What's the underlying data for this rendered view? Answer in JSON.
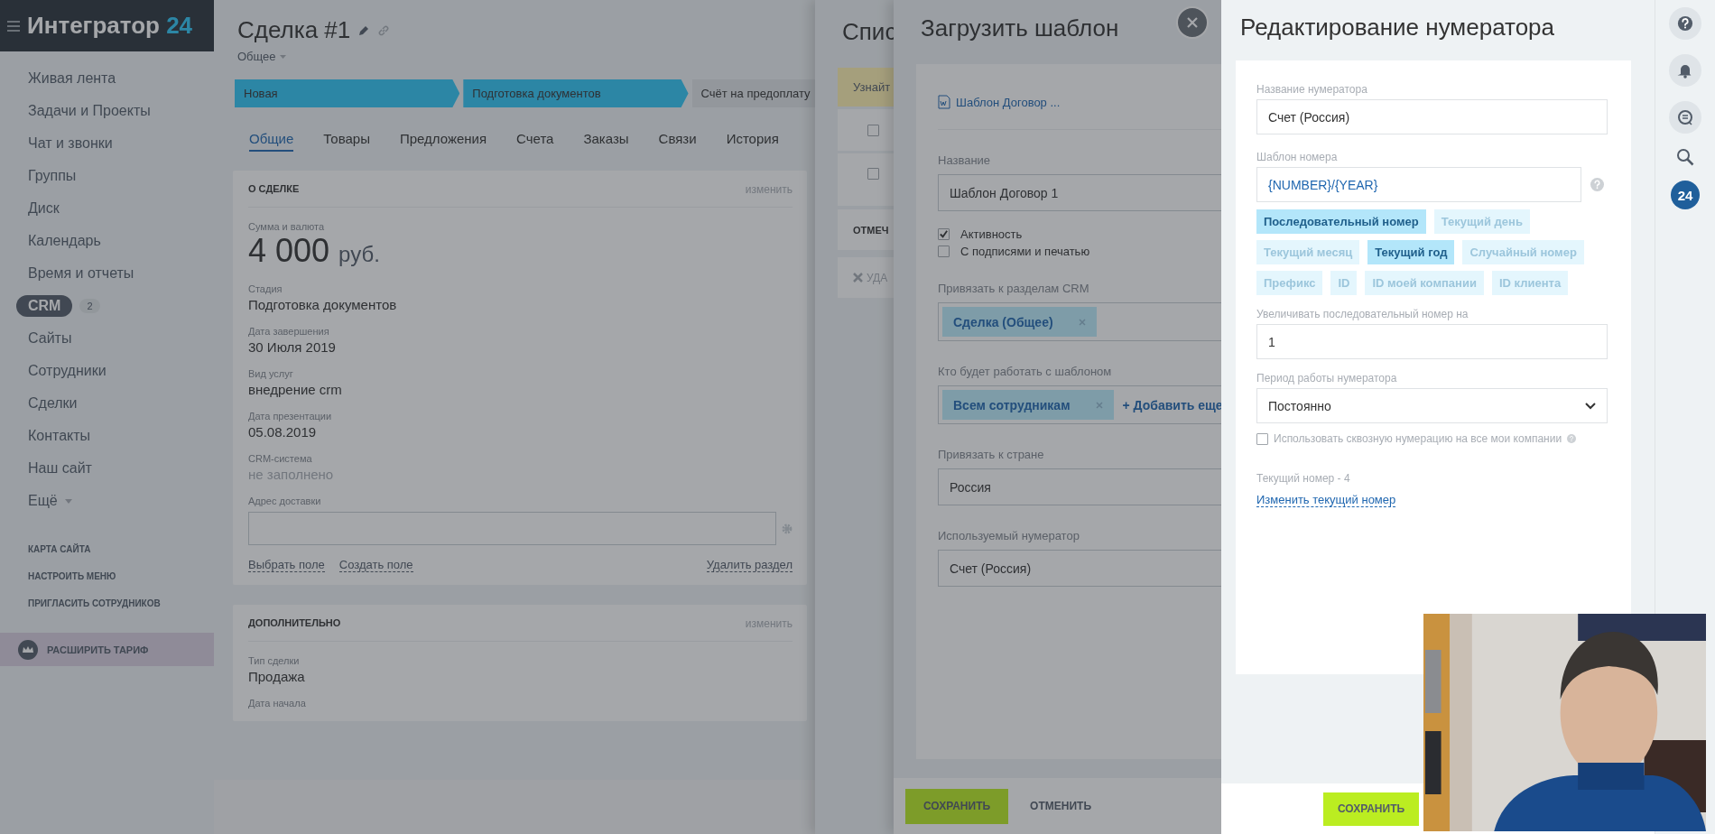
{
  "sidebar": {
    "logo": "Интегратор",
    "logo_number": "24",
    "items": [
      {
        "label": "Живая лента",
        "selected": false
      },
      {
        "label": "Задачи и Проекты",
        "selected": false
      },
      {
        "label": "Чат и звонки",
        "selected": false
      },
      {
        "label": "Группы",
        "selected": false
      },
      {
        "label": "Диск",
        "selected": false
      },
      {
        "label": "Календарь",
        "selected": false
      },
      {
        "label": "Время и отчеты",
        "selected": false
      },
      {
        "label": "CRM",
        "selected": true,
        "badge": "2"
      },
      {
        "label": "Сайты",
        "selected": false
      },
      {
        "label": "Сотрудники",
        "selected": false
      },
      {
        "label": "Сделки",
        "selected": false
      },
      {
        "label": "Контакты",
        "selected": false
      },
      {
        "label": "Наш сайт",
        "selected": false
      },
      {
        "label": "Ещё",
        "selected": false,
        "expandable": true
      }
    ],
    "links": [
      "КАРТА САЙТА",
      "НАСТРОИТЬ МЕНЮ",
      "ПРИГЛАСИТЬ СОТРУДНИКОВ"
    ],
    "upgrade": "РАСШИРИТЬ ТАРИФ"
  },
  "deal": {
    "title": "Сделка #1",
    "category": "Общее",
    "stages": [
      {
        "label": "Новая",
        "reached": true
      },
      {
        "label": "Подготовка документов",
        "reached": true
      },
      {
        "label": "Счёт на предоплату",
        "reached": false
      }
    ],
    "tabs": [
      {
        "label": "Общие",
        "selected": true
      },
      {
        "label": "Товары",
        "selected": false
      },
      {
        "label": "Предложения",
        "selected": false
      },
      {
        "label": "Счета",
        "selected": false
      },
      {
        "label": "Заказы",
        "selected": false
      },
      {
        "label": "Связи",
        "selected": false
      },
      {
        "label": "История",
        "selected": false
      }
    ],
    "sections": [
      {
        "title": "О СДЕЛКЕ",
        "edit": "изменить",
        "fields": [
          {
            "kind": "money",
            "label": "Сумма и валюта",
            "value": "4 000",
            "currency": "руб."
          },
          {
            "kind": "text",
            "label": "Стадия",
            "value": "Подготовка документов"
          },
          {
            "kind": "text",
            "label": "Дата завершения",
            "value": "30 Июля 2019"
          },
          {
            "kind": "text",
            "label": "Вид услуг",
            "value": "внедрение crm"
          },
          {
            "kind": "text",
            "label": "Дата презентации",
            "value": "05.08.2019"
          },
          {
            "kind": "empty",
            "label": "CRM-система",
            "value": "не заполнено"
          },
          {
            "kind": "input",
            "label": "Адрес доставки"
          }
        ],
        "actions": [
          "Выбрать поле",
          "Создать поле"
        ],
        "remove": "Удалить раздел"
      },
      {
        "title": "ДОПОЛНИТЕЛЬНО",
        "edit": "изменить",
        "fields": [
          {
            "kind": "text",
            "label": "Тип сделки",
            "value": "Продажа"
          },
          {
            "kind": "label",
            "label": "Дата начала"
          }
        ]
      }
    ]
  },
  "list_panel": {
    "title": "Спис",
    "notice": "Узнайт",
    "rows": [
      {
        "checked": false
      },
      {
        "checked": false
      }
    ],
    "mark": "ОТМЕЧ",
    "delete": "УДА"
  },
  "template_panel": {
    "title": "Загрузить шаблон",
    "file": "Шаблон Договор ...",
    "name_label": "Название",
    "name_value": "Шаблон Договор 1",
    "checkboxes": [
      {
        "label": "Активность",
        "checked": true
      },
      {
        "label": "С подписями и печатью",
        "checked": false
      }
    ],
    "sections_label": "Привязать к разделам CRM",
    "sections_tags": [
      "Сделка (Общее)"
    ],
    "users_label": "Кто будет работать с шаблоном",
    "users_tags": [
      "Всем сотрудникам"
    ],
    "add_more": "+ Добавить еще",
    "country_label": "Привязать к стране",
    "country_value": "Россия",
    "numerator_label": "Используемый нумератор",
    "numerator_value": "Счет (Россия)",
    "save": "СОХРАНИТЬ",
    "cancel": "ОТМЕНИТЬ"
  },
  "numerator_panel": {
    "title": "Редактирование нумератора",
    "name_label": "Название нумератора",
    "name_value": "Счет (Россия)",
    "template_label": "Шаблон номера",
    "template_value": "{NUMBER}/{YEAR}",
    "tags": [
      {
        "label": "Последовательный номер",
        "selected": true
      },
      {
        "label": "Текущий день",
        "selected": false
      },
      {
        "label": "Текущий месяц",
        "selected": false
      },
      {
        "label": "Текущий год",
        "selected": true
      },
      {
        "label": "Случайный номер",
        "selected": false
      },
      {
        "label": "Префикс",
        "selected": false
      },
      {
        "label": "ID",
        "selected": false
      },
      {
        "label": "ID моей компании",
        "selected": false
      },
      {
        "label": "ID клиента",
        "selected": false
      }
    ],
    "step_label": "Увеличивать последовательный номер на",
    "step_value": "1",
    "period_label": "Период работы нумератора",
    "period_value": "Постоянно",
    "cross": {
      "label": "Использовать сквозную нумерацию на все мои компании",
      "checked": false
    },
    "current": "Текущий номер - 4",
    "change_link": "Изменить текущий номер",
    "save": "СОХРАНИТЬ"
  },
  "right_bar": {
    "counter": "24"
  }
}
